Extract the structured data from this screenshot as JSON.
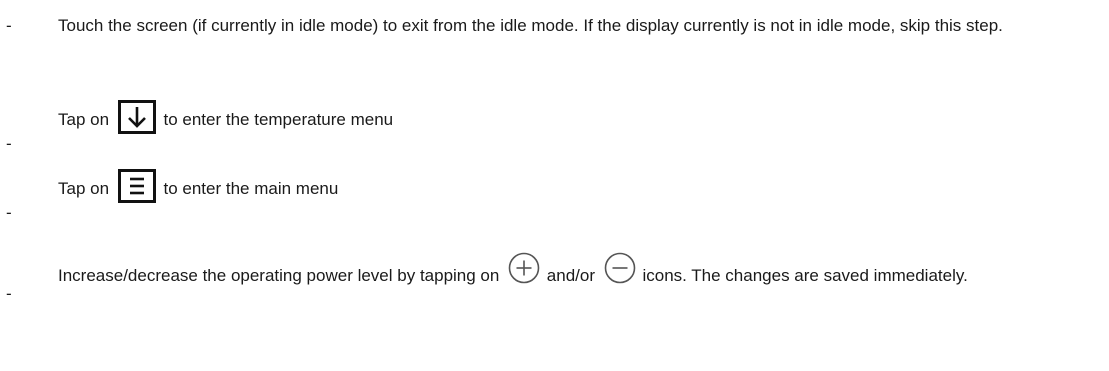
{
  "steps": [
    {
      "dash": "-",
      "text": "Touch the screen (if currently in idle mode) to exit from the idle mode. If the display currently is not in idle mode, skip this step."
    },
    {
      "dash": "-",
      "before": "Tap on",
      "icon": "arrow-down-box-icon",
      "after": "to enter the temperature menu"
    },
    {
      "dash": "-",
      "before": "Tap on",
      "icon": "menu-box-icon",
      "after": "to enter the main menu"
    },
    {
      "dash": "-",
      "before": "Increase/decrease the operating power level by tapping on",
      "icon1": "plus-circle-icon",
      "middle": "and/or",
      "icon2": "minus-circle-icon",
      "after": "icons. The changes are saved immediately."
    }
  ]
}
